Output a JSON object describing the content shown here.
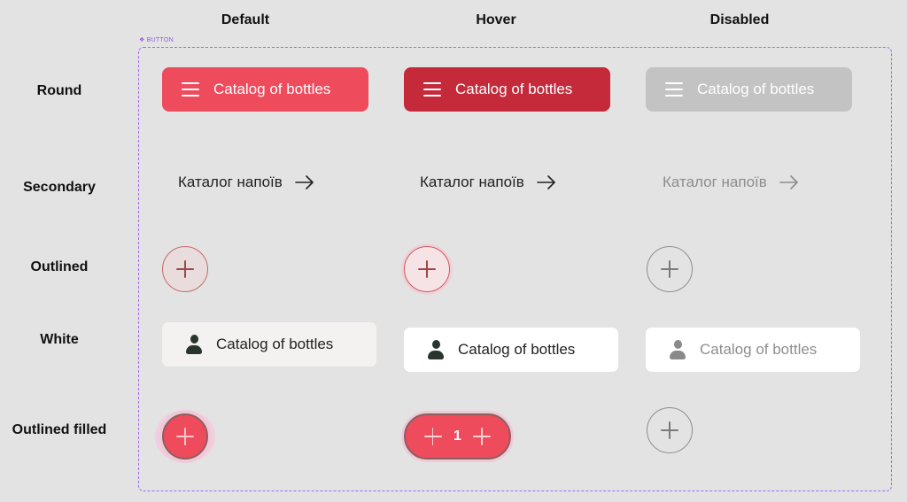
{
  "columns": {
    "default": "Default",
    "hover": "Hover",
    "disabled": "Disabled"
  },
  "rows": {
    "round": "Round",
    "secondary": "Secondary",
    "outlined": "Outlined",
    "white": "White",
    "outlined_filled": "Outlined filled"
  },
  "frame_label": "BUTTON",
  "round_buttons": {
    "label": "Catalog of bottles"
  },
  "secondary_buttons": {
    "label": "Каталог напоїв"
  },
  "white_buttons": {
    "label": "Catalog of bottles"
  },
  "outlined_filled": {
    "hover_count": "1"
  },
  "colors": {
    "accent": "#ee4b5c",
    "accent_hover": "#c42a3a",
    "disabled": "#c3c3c3",
    "frame": "#9b6cf0",
    "background": "#e3e3e3"
  },
  "icons": {
    "round": "menu-icon",
    "secondary": "arrow-right-icon",
    "outlined": "plus-icon",
    "white": "user-icon"
  }
}
